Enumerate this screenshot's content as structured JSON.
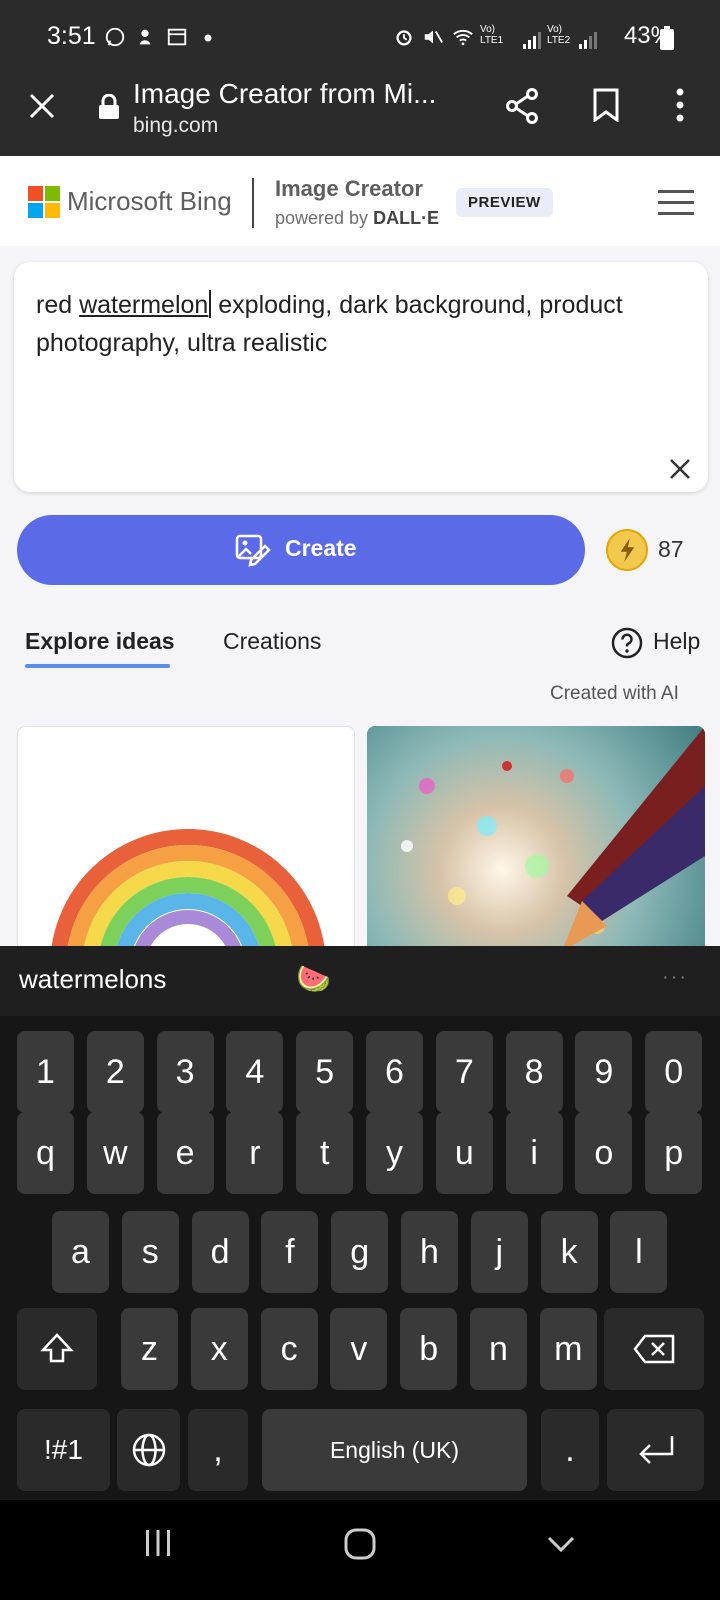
{
  "status_bar": {
    "time": "3:51",
    "signal1": "Vo) LTE1",
    "signal2": "Vo) LTE2",
    "battery": "43%"
  },
  "browser": {
    "title": "Image Creator from Mi...",
    "url": "bing.com"
  },
  "header": {
    "brand": "Microsoft Bing",
    "product_title": "Image Creator",
    "powered_by": "powered by",
    "powered_by_brand": "DALL·E",
    "badge": "PREVIEW"
  },
  "prompt": {
    "before": "red ",
    "underlined": "watermelon",
    "after": " exploding, dark background, product photography, ultra realistic"
  },
  "create": {
    "label": "Create",
    "boosts": "87"
  },
  "tabs": [
    {
      "label": "Explore ideas",
      "active": true
    },
    {
      "label": "Creations",
      "active": false
    }
  ],
  "help": {
    "label": "Help"
  },
  "created_with_ai": "Created with AI",
  "keyboard": {
    "suggestion": "watermelons",
    "suggestion_emoji": "🍉",
    "more": "···",
    "row_numbers": [
      "1",
      "2",
      "3",
      "4",
      "5",
      "6",
      "7",
      "8",
      "9",
      "0"
    ],
    "row_q": [
      "q",
      "w",
      "e",
      "r",
      "t",
      "y",
      "u",
      "i",
      "o",
      "p"
    ],
    "row_a": [
      "a",
      "s",
      "d",
      "f",
      "g",
      "h",
      "j",
      "k",
      "l"
    ],
    "row_z": [
      "z",
      "x",
      "c",
      "v",
      "b",
      "n",
      "m"
    ],
    "symbols": "!#1",
    "comma": ",",
    "space": "English (UK)",
    "period": "."
  }
}
